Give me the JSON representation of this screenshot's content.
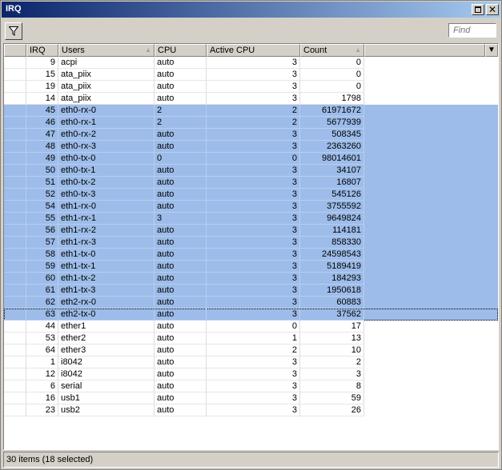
{
  "window": {
    "title": "IRQ"
  },
  "toolbar": {
    "find_placeholder": "Find"
  },
  "table": {
    "columns": [
      "IRQ",
      "Users",
      "CPU",
      "Active CPU",
      "Count"
    ],
    "rows": [
      {
        "irq": "9",
        "users": "acpi",
        "cpu": "auto",
        "active_cpu": "3",
        "count": "0",
        "selected": false
      },
      {
        "irq": "15",
        "users": "ata_piix",
        "cpu": "auto",
        "active_cpu": "3",
        "count": "0",
        "selected": false
      },
      {
        "irq": "19",
        "users": "ata_piix",
        "cpu": "auto",
        "active_cpu": "3",
        "count": "0",
        "selected": false
      },
      {
        "irq": "14",
        "users": "ata_piix",
        "cpu": "auto",
        "active_cpu": "3",
        "count": "1798",
        "selected": false
      },
      {
        "irq": "45",
        "users": "eth0-rx-0",
        "cpu": "2",
        "active_cpu": "2",
        "count": "61971672",
        "selected": true
      },
      {
        "irq": "46",
        "users": "eth0-rx-1",
        "cpu": "2",
        "active_cpu": "2",
        "count": "5677939",
        "selected": true
      },
      {
        "irq": "47",
        "users": "eth0-rx-2",
        "cpu": "auto",
        "active_cpu": "3",
        "count": "508345",
        "selected": true
      },
      {
        "irq": "48",
        "users": "eth0-rx-3",
        "cpu": "auto",
        "active_cpu": "3",
        "count": "2363260",
        "selected": true
      },
      {
        "irq": "49",
        "users": "eth0-tx-0",
        "cpu": "0",
        "active_cpu": "0",
        "count": "98014601",
        "selected": true
      },
      {
        "irq": "50",
        "users": "eth0-tx-1",
        "cpu": "auto",
        "active_cpu": "3",
        "count": "34107",
        "selected": true
      },
      {
        "irq": "51",
        "users": "eth0-tx-2",
        "cpu": "auto",
        "active_cpu": "3",
        "count": "16807",
        "selected": true
      },
      {
        "irq": "52",
        "users": "eth0-tx-3",
        "cpu": "auto",
        "active_cpu": "3",
        "count": "545126",
        "selected": true
      },
      {
        "irq": "54",
        "users": "eth1-rx-0",
        "cpu": "auto",
        "active_cpu": "3",
        "count": "3755592",
        "selected": true
      },
      {
        "irq": "55",
        "users": "eth1-rx-1",
        "cpu": "3",
        "active_cpu": "3",
        "count": "9649824",
        "selected": true
      },
      {
        "irq": "56",
        "users": "eth1-rx-2",
        "cpu": "auto",
        "active_cpu": "3",
        "count": "114181",
        "selected": true
      },
      {
        "irq": "57",
        "users": "eth1-rx-3",
        "cpu": "auto",
        "active_cpu": "3",
        "count": "858330",
        "selected": true
      },
      {
        "irq": "58",
        "users": "eth1-tx-0",
        "cpu": "auto",
        "active_cpu": "3",
        "count": "24598543",
        "selected": true
      },
      {
        "irq": "59",
        "users": "eth1-tx-1",
        "cpu": "auto",
        "active_cpu": "3",
        "count": "5189419",
        "selected": true
      },
      {
        "irq": "60",
        "users": "eth1-tx-2",
        "cpu": "auto",
        "active_cpu": "3",
        "count": "184293",
        "selected": true
      },
      {
        "irq": "61",
        "users": "eth1-tx-3",
        "cpu": "auto",
        "active_cpu": "3",
        "count": "1950618",
        "selected": true
      },
      {
        "irq": "62",
        "users": "eth2-rx-0",
        "cpu": "auto",
        "active_cpu": "3",
        "count": "60883",
        "selected": true
      },
      {
        "irq": "63",
        "users": "eth2-tx-0",
        "cpu": "auto",
        "active_cpu": "3",
        "count": "37562",
        "selected": true,
        "focused": true
      },
      {
        "irq": "44",
        "users": "ether1",
        "cpu": "auto",
        "active_cpu": "0",
        "count": "17",
        "selected": false
      },
      {
        "irq": "53",
        "users": "ether2",
        "cpu": "auto",
        "active_cpu": "1",
        "count": "13",
        "selected": false
      },
      {
        "irq": "64",
        "users": "ether3",
        "cpu": "auto",
        "active_cpu": "2",
        "count": "10",
        "selected": false
      },
      {
        "irq": "1",
        "users": "i8042",
        "cpu": "auto",
        "active_cpu": "3",
        "count": "2",
        "selected": false
      },
      {
        "irq": "12",
        "users": "i8042",
        "cpu": "auto",
        "active_cpu": "3",
        "count": "3",
        "selected": false
      },
      {
        "irq": "6",
        "users": "serial",
        "cpu": "auto",
        "active_cpu": "3",
        "count": "8",
        "selected": false
      },
      {
        "irq": "16",
        "users": "usb1",
        "cpu": "auto",
        "active_cpu": "3",
        "count": "59",
        "selected": false
      },
      {
        "irq": "23",
        "users": "usb2",
        "cpu": "auto",
        "active_cpu": "3",
        "count": "26",
        "selected": false
      }
    ]
  },
  "status": {
    "text": "30 items (18 selected)"
  },
  "colors": {
    "selection": "#9dbce9",
    "title_start": "#0a246a",
    "title_end": "#a6caf0"
  }
}
